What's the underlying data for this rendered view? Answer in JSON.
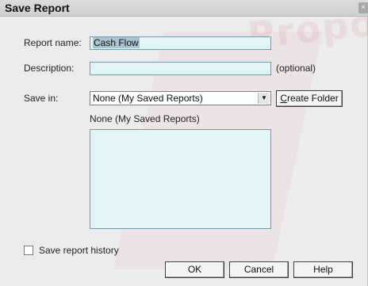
{
  "dialog": {
    "title": "Save Report",
    "close_glyph": "×",
    "watermark": "Propos"
  },
  "form": {
    "report_name_label": "Report name:",
    "report_name_value": "Cash Flow",
    "description_label": "Description:",
    "description_value": "",
    "optional_hint": "(optional)",
    "save_in_label": "Save in:",
    "save_in_value": "None (My Saved Reports)",
    "folder_list_heading": "None (My Saved Reports)",
    "folder_items": [],
    "save_history_label": "Save report history",
    "save_history_checked": false
  },
  "buttons": {
    "create_folder_prefix": "",
    "create_folder_mnemonic": "C",
    "create_folder_rest": "reate Folder",
    "ok": "OK",
    "cancel": "Cancel",
    "help": "Help"
  },
  "icons": {
    "close": "close-icon",
    "dropdown": "chevron-down-icon"
  }
}
